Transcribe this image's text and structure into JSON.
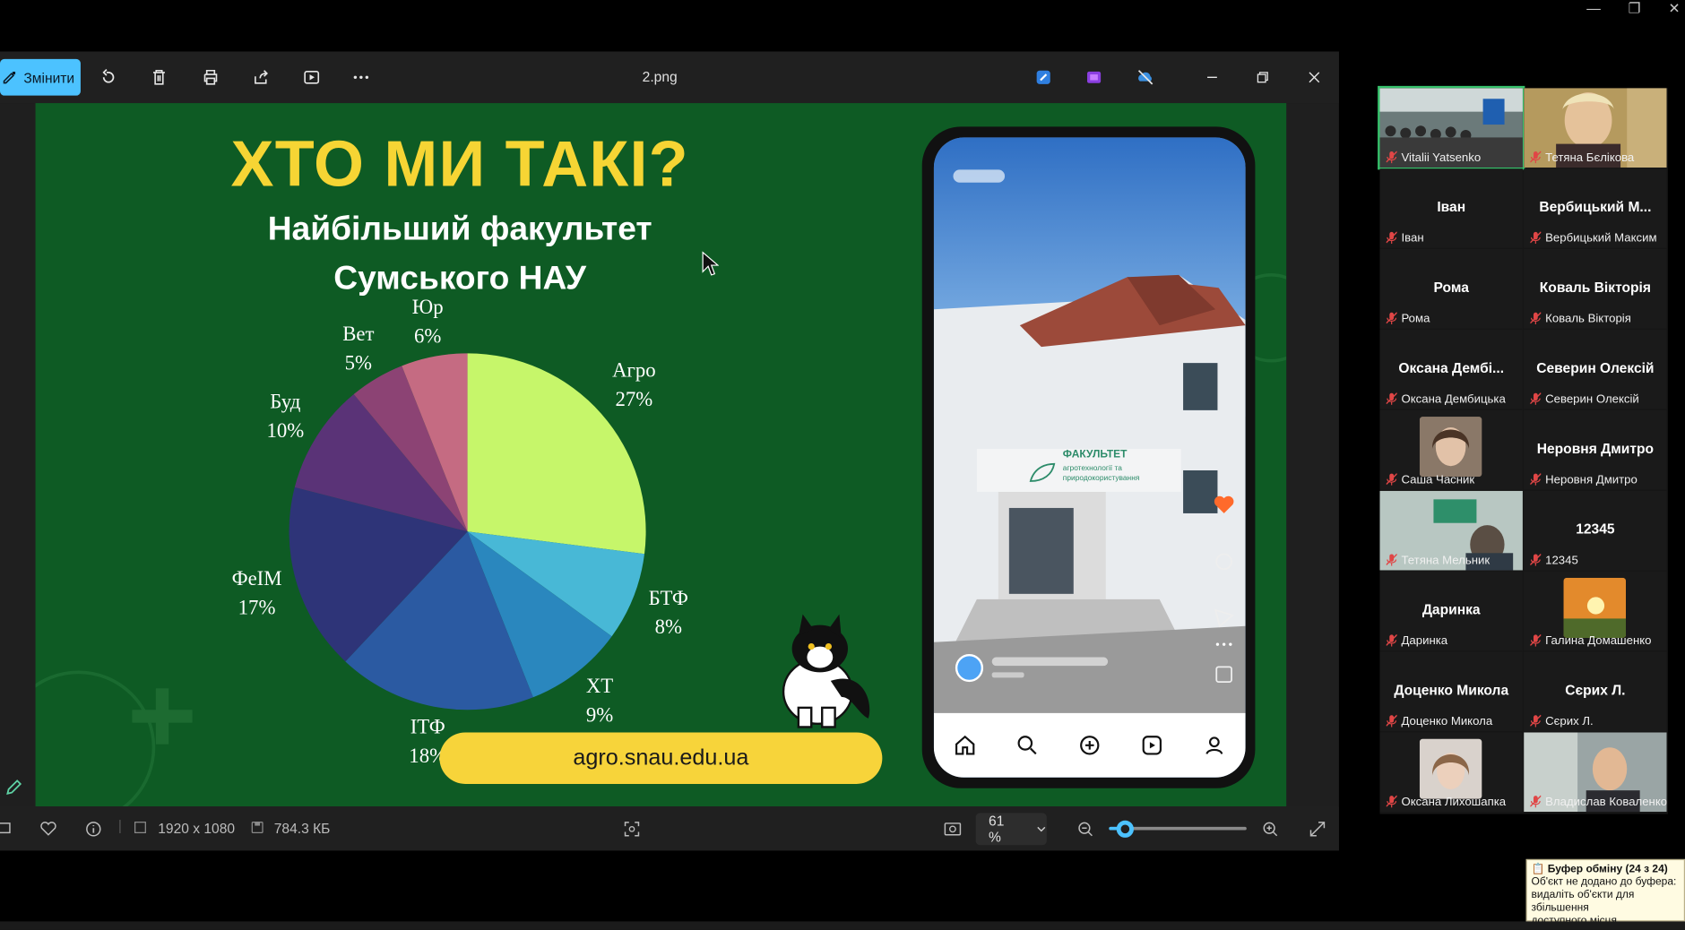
{
  "window": {
    "file_name": "2.png",
    "edit_label": "Змінити"
  },
  "slide": {
    "title": "ХТО МИ ТАКІ?",
    "subtitle_line1": "Найбільший факультет",
    "subtitle_line2": "Сумського НАУ",
    "url": "agro.snau.edu.ua",
    "phone_sign_title": "ФАКУЛЬТЕТ",
    "phone_sign_line1": "агротехнології та",
    "phone_sign_line2": "природокористування"
  },
  "pie": {
    "slices": [
      {
        "name": "Агро",
        "pct_label": "27%",
        "value": 27,
        "color": "#c6f66a"
      },
      {
        "name": "БТФ",
        "pct_label": "8%",
        "value": 8,
        "color": "#48b8d6"
      },
      {
        "name": "ХТ",
        "pct_label": "9%",
        "value": 9,
        "color": "#2a87be"
      },
      {
        "name": "ІТФ",
        "pct_label": "18%",
        "value": 18,
        "color": "#2b5aa2"
      },
      {
        "name": "ФеІМ",
        "pct_label": "17%",
        "value": 17,
        "color": "#2e3478"
      },
      {
        "name": "Буд",
        "pct_label": "10%",
        "value": 10,
        "color": "#5a3377"
      },
      {
        "name": "Вет",
        "pct_label": "5%",
        "value": 5,
        "color": "#8c4374"
      },
      {
        "name": "Юр",
        "pct_label": "6%",
        "value": 6,
        "color": "#c56b82"
      }
    ]
  },
  "status": {
    "dimensions": "1920 x 1080",
    "size": "784.3 КБ",
    "zoom": "61 %",
    "zoom_level": 0.12
  },
  "participants": [
    {
      "big": "",
      "small": "Vitalii Yatsenko",
      "photo": "video-classroom"
    },
    {
      "big": "",
      "small": "Тетяна Бєлікова",
      "photo": "video-woman"
    },
    {
      "big": "Іван",
      "small": "Іван"
    },
    {
      "big": "Вербицький М...",
      "small": "Вербицький Максим"
    },
    {
      "big": "Рома",
      "small": "Рома"
    },
    {
      "big": "Коваль Вікторія",
      "small": "Коваль Вікторія"
    },
    {
      "big": "Оксана Дембі...",
      "small": "Оксана Дембицька"
    },
    {
      "big": "Северин Олексій",
      "small": "Северин Олексій"
    },
    {
      "big": "",
      "small": "Саша Часник",
      "photo": "avatar-woman"
    },
    {
      "big": "Неровня Дмитро",
      "small": "Неровня Дмитро"
    },
    {
      "big": "",
      "small": "Тетяна Мельник",
      "photo": "video-office"
    },
    {
      "big": "12345",
      "small": "12345"
    },
    {
      "big": "Даринка",
      "small": "Даринка"
    },
    {
      "big": "",
      "small": "Галина Домашенко",
      "photo": "avatar-sunset"
    },
    {
      "big": "Доценко Микола",
      "small": "Доценко Микола"
    },
    {
      "big": "Сєрих Л.",
      "small": "Сєрих Л."
    },
    {
      "big": "",
      "small": "Оксана Лихошапка",
      "photo": "avatar-woman2"
    },
    {
      "big": "",
      "small": "Владислав Коваленко",
      "photo": "video-man"
    }
  ],
  "toast": {
    "title": "Буфер обміну (24 з 24)",
    "body_line1": "Об'єкт не додано до буфера:",
    "body_line2": "видаліть об'єкти для збільшення",
    "body_line3": "доступного місця"
  }
}
